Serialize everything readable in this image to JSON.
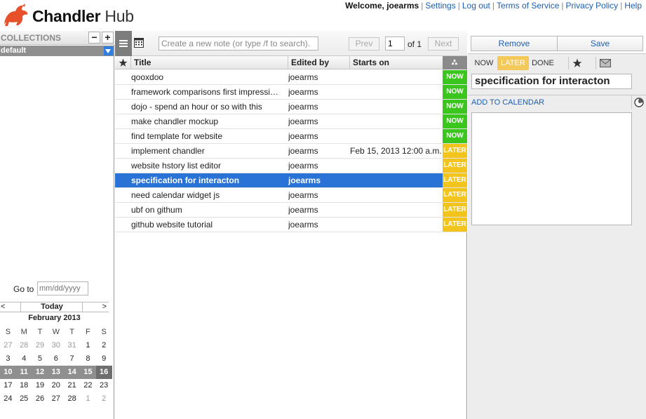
{
  "brand": {
    "name": "Chandler",
    "suffix": "Hub"
  },
  "top_nav": {
    "welcome": "Welcome, joearms",
    "links": [
      "Settings",
      "Log out",
      "Terms of Service",
      "Privacy Policy",
      "Help"
    ]
  },
  "collections": {
    "title": "COLLECTIONS",
    "remove_label": "−",
    "add_label": "+",
    "selected": "default"
  },
  "goto": {
    "label": "Go to",
    "placeholder": "mm/dd/yyyy"
  },
  "calendar": {
    "prev": "<",
    "today": "Today",
    "next": ">",
    "month": "February 2013",
    "weekdays": [
      "S",
      "M",
      "T",
      "W",
      "T",
      "F",
      "S"
    ],
    "weeks": [
      [
        "27",
        "28",
        "29",
        "30",
        "31",
        "1",
        "2"
      ],
      [
        "3",
        "4",
        "5",
        "6",
        "7",
        "8",
        "9"
      ],
      [
        "10",
        "11",
        "12",
        "13",
        "14",
        "15",
        "16"
      ],
      [
        "17",
        "18",
        "19",
        "20",
        "21",
        "22",
        "23"
      ],
      [
        "24",
        "25",
        "26",
        "27",
        "28",
        "1",
        "2"
      ]
    ],
    "selected_week": 2,
    "current_day": "16"
  },
  "toolbar": {
    "search_placeholder": "Create a new note (or type /f to search).",
    "prev": "Prev",
    "page": "1",
    "of": "of 1",
    "next": "Next"
  },
  "table": {
    "columns": {
      "title": "Title",
      "edited_by": "Edited by",
      "starts_on": "Starts on"
    },
    "triage_icon": "recycle-icon",
    "rows": [
      {
        "title": "qooxdoo",
        "edited_by": "joearms",
        "starts_on": "",
        "triage": "NOW"
      },
      {
        "title": "framework comparisons first impressi…",
        "edited_by": "joearms",
        "starts_on": "",
        "triage": "NOW"
      },
      {
        "title": "dojo - spend an hour or so with this",
        "edited_by": "joearms",
        "starts_on": "",
        "triage": "NOW"
      },
      {
        "title": "make chandler mockup",
        "edited_by": "joearms",
        "starts_on": "",
        "triage": "NOW"
      },
      {
        "title": "find template for website",
        "edited_by": "joearms",
        "starts_on": "",
        "triage": "NOW"
      },
      {
        "title": "implement chandler",
        "edited_by": "joearms",
        "starts_on": "Feb 15, 2013 12:00 a.m.",
        "triage": "LATER"
      },
      {
        "title": "website hstory list editor",
        "edited_by": "joearms",
        "starts_on": "",
        "triage": "LATER"
      },
      {
        "title": "specification for interacton",
        "edited_by": "joearms",
        "starts_on": "",
        "triage": "LATER",
        "selected": true
      },
      {
        "title": "need calendar widget js",
        "edited_by": "joearms",
        "starts_on": "",
        "triage": "LATER"
      },
      {
        "title": "ubf on githum",
        "edited_by": "joearms",
        "starts_on": "",
        "triage": "LATER"
      },
      {
        "title": "github website tutorial",
        "edited_by": "joearms",
        "starts_on": "",
        "triage": "LATER"
      }
    ]
  },
  "detail": {
    "remove": "Remove",
    "save": "Save",
    "triage": [
      "NOW",
      "LATER",
      "DONE"
    ],
    "active_triage": "LATER",
    "title": "specification for interacton",
    "add_to_calendar": "ADD TO CALENDAR",
    "body": ""
  },
  "colors": {
    "now": "#3ac61d",
    "later": "#f2c41c",
    "selection": "#2a73d6",
    "link": "#1a5fb4",
    "brand_logo": "#e8502a"
  }
}
